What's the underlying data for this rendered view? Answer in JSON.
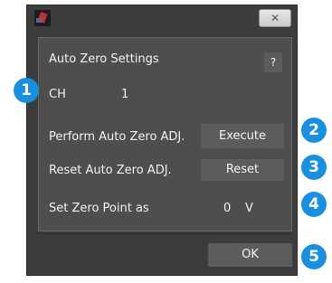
{
  "window": {
    "close_glyph": "✕"
  },
  "panel": {
    "title": "Auto Zero Settings",
    "help_label": "?",
    "ch_label": "CH",
    "ch_value": "1",
    "perform_label": "Perform Auto Zero ADJ.",
    "execute_label": "Execute",
    "reset_label_text": "Reset Auto Zero ADJ.",
    "reset_button_label": "Reset",
    "zero_point_label": "Set Zero Point as",
    "zero_point_value": "0",
    "zero_point_unit": "V"
  },
  "footer": {
    "ok_label": "OK"
  },
  "badges": [
    "1",
    "2",
    "3",
    "4",
    "5"
  ],
  "colors": {
    "badge": "#1a8fe0",
    "dialog_bg": "#3c3c3c",
    "panel_bg": "#4e4e4e",
    "button_bg": "#5c5c5c"
  }
}
